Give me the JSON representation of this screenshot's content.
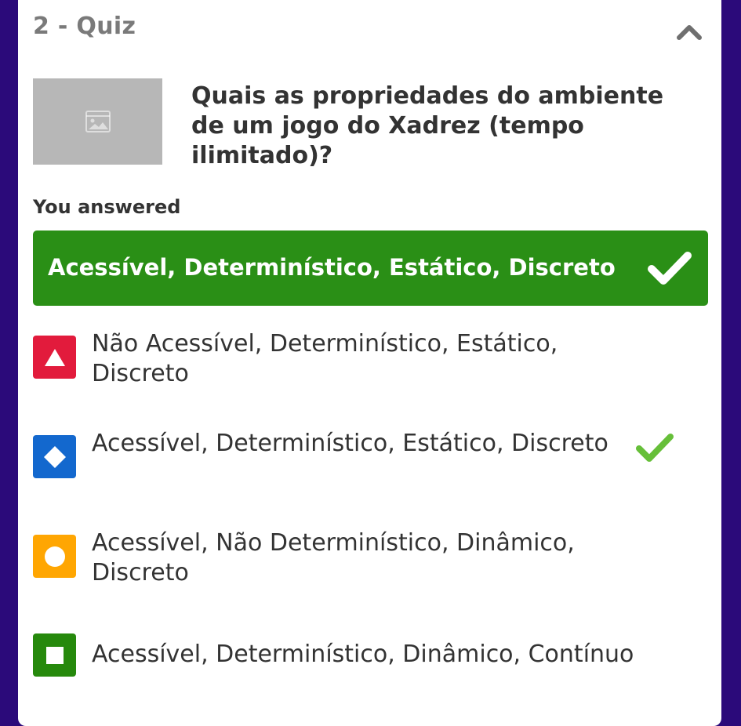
{
  "quiz": {
    "header_title": "2 - Quiz",
    "question": "Quais as propriedades do ambiente de um jogo do Xadrez (tempo ilimitado)?",
    "you_answered_label": "You answered",
    "selected_answer": "Acessível, Determinístico, Estático, Discreto",
    "options": [
      {
        "label": "Não Acessível, Determinístico, Estático, Discreto",
        "shape": "triangle",
        "color": "#e21b3c",
        "correct": false
      },
      {
        "label": "Acessível, Determinístico, Estático, Discreto",
        "shape": "diamond",
        "color": "#1368ce",
        "correct": true
      },
      {
        "label": "Acessível, Não Determinístico, Dinâmico, Discreto",
        "shape": "circle",
        "color": "#ffa602",
        "correct": false
      },
      {
        "label": "Acessível, Determinístico, Dinâmico, Contínuo",
        "shape": "square",
        "color": "#26890c",
        "correct": false
      }
    ]
  },
  "icons": {
    "collapse": "chevron-up-icon",
    "thumbnail": "image-placeholder-icon",
    "selected_check": "check-icon",
    "correct_check": "check-icon"
  },
  "colors": {
    "background": "#2b0a7a",
    "correct_banner": "#2a8f16",
    "correct_check": "#66bf39",
    "header_text": "#7a7a7a"
  }
}
